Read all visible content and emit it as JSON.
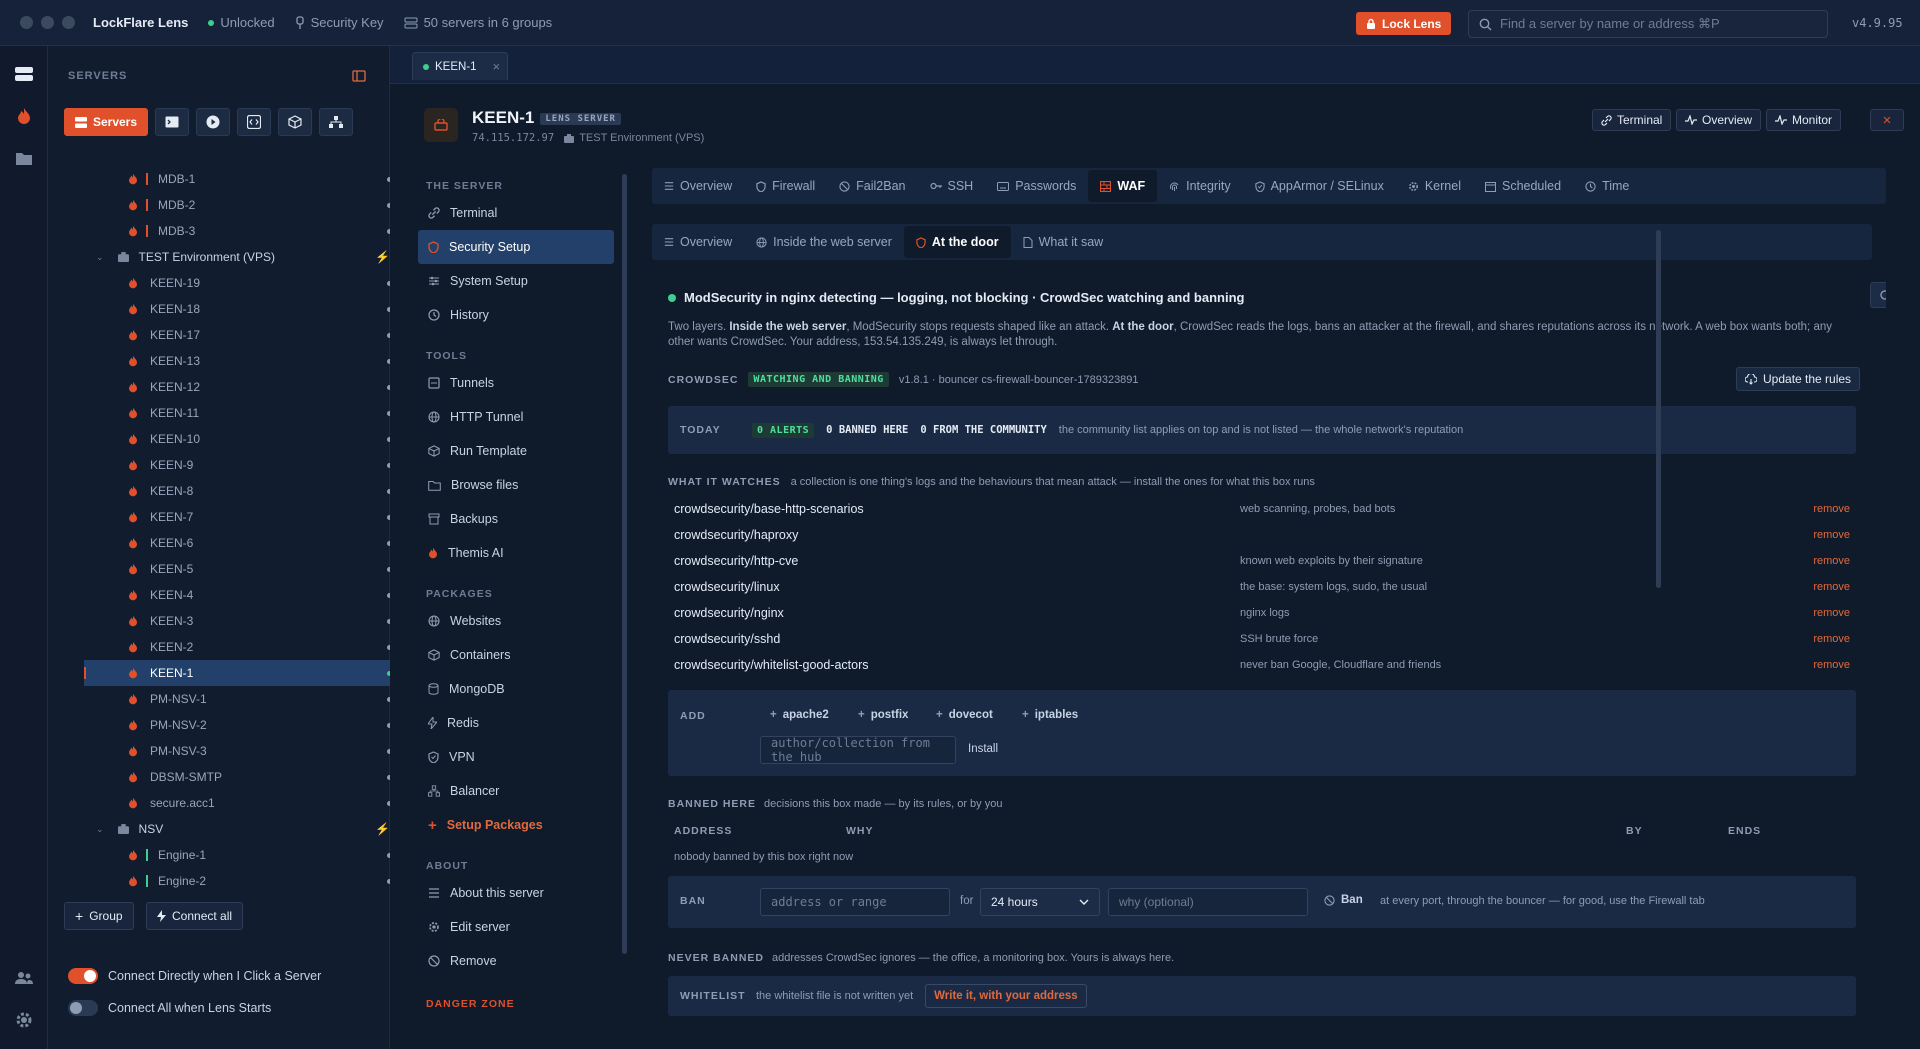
{
  "titlebar": {
    "app_name": "LockFlare Lens",
    "unlocked": "Unlocked",
    "security_key": "Security Key",
    "servers_info": "50 servers in 6 groups",
    "lock_button": "Lock Lens",
    "search_placeholder": "Find a server by name or address ⌘P",
    "version": "v4.9.95"
  },
  "sidebar": {
    "title": "SERVERS",
    "servers_tab": "Servers",
    "group_button": "Group",
    "connect_all_button": "Connect all",
    "toggles": [
      {
        "label": "Connect Directly when I Click a Server",
        "on": true
      },
      {
        "label": "Connect All when Lens Starts",
        "on": false
      }
    ],
    "tree": [
      {
        "type": "server",
        "name": "MDB-1",
        "bar": "#e0502a"
      },
      {
        "type": "server",
        "name": "MDB-2",
        "bar": "#e0502a"
      },
      {
        "type": "server",
        "name": "MDB-3",
        "bar": "#e0502a"
      },
      {
        "type": "group",
        "name": "TEST Environment (VPS)"
      },
      {
        "type": "server",
        "name": "KEEN-19"
      },
      {
        "type": "server",
        "name": "KEEN-18"
      },
      {
        "type": "server",
        "name": "KEEN-17"
      },
      {
        "type": "server",
        "name": "KEEN-13"
      },
      {
        "type": "server",
        "name": "KEEN-12"
      },
      {
        "type": "server",
        "name": "KEEN-11"
      },
      {
        "type": "server",
        "name": "KEEN-10"
      },
      {
        "type": "server",
        "name": "KEEN-9"
      },
      {
        "type": "server",
        "name": "KEEN-8"
      },
      {
        "type": "server",
        "name": "KEEN-7"
      },
      {
        "type": "server",
        "name": "KEEN-6"
      },
      {
        "type": "server",
        "name": "KEEN-5"
      },
      {
        "type": "server",
        "name": "KEEN-4"
      },
      {
        "type": "server",
        "name": "KEEN-3"
      },
      {
        "type": "server",
        "name": "KEEN-2"
      },
      {
        "type": "server",
        "name": "KEEN-1",
        "selected": true
      },
      {
        "type": "server",
        "name": "PM-NSV-1"
      },
      {
        "type": "server",
        "name": "PM-NSV-2"
      },
      {
        "type": "server",
        "name": "PM-NSV-3"
      },
      {
        "type": "server",
        "name": "DBSM-SMTP"
      },
      {
        "type": "server",
        "name": "secure.acc1"
      },
      {
        "type": "group",
        "name": "NSV"
      },
      {
        "type": "server",
        "name": "Engine-1",
        "bar": "#3ecf8e"
      },
      {
        "type": "server",
        "name": "Engine-2",
        "bar": "#3ecf8e"
      }
    ]
  },
  "tab": {
    "label": "KEEN-1"
  },
  "server": {
    "name": "KEEN-1",
    "badge": "LENS SERVER",
    "ip": "74.115.172.97",
    "env": "TEST Environment (VPS)",
    "buttons": {
      "terminal": "Terminal",
      "overview": "Overview",
      "monitor": "Monitor"
    }
  },
  "leftnav": {
    "sec_server": "THE SERVER",
    "server_items": [
      "Terminal",
      "Security Setup",
      "System Setup",
      "History"
    ],
    "sec_tools": "TOOLS",
    "tool_items": [
      "Tunnels",
      "HTTP Tunnel",
      "Run Template",
      "Browse files",
      "Backups",
      "Themis AI"
    ],
    "sec_packages": "PACKAGES",
    "package_items": [
      "Websites",
      "Containers",
      "MongoDB",
      "Redis",
      "VPN",
      "Balancer",
      "Setup Packages"
    ],
    "sec_about": "ABOUT",
    "about_items": [
      "About this server",
      "Edit server",
      "Remove"
    ],
    "danger": "DANGER ZONE"
  },
  "toptabs": [
    "Overview",
    "Firewall",
    "Fail2Ban",
    "SSH",
    "Passwords",
    "WAF",
    "Integrity",
    "AppArmor / SELinux",
    "Kernel",
    "Scheduled",
    "Time"
  ],
  "subtabs": [
    "Overview",
    "Inside the web server",
    "At the door",
    "What it saw"
  ],
  "waf": {
    "status": "ModSecurity in nginx detecting — logging, not blocking · CrowdSec watching and banning",
    "desc_1": "Two layers. ",
    "desc_b1": "Inside the web server",
    "desc_2": ", ModSecurity stops requests shaped like an attack. ",
    "desc_b2": "At the door",
    "desc_3": ", CrowdSec reads the logs, bans an attacker at the firewall, and shares reputations across its network. A web box wants both; any other wants CrowdSec. Your address, 153.54.135.249, is always let through.",
    "crowdsec_label": "CROWDSEC",
    "crowdsec_state": "WATCHING AND BANNING",
    "crowdsec_version": "v1.8.1 · bouncer cs-firewall-bouncer-1789323891",
    "update_button": "Update the rules",
    "today_label": "TODAY",
    "alerts": "0 ALERTS",
    "banned_here": "0 BANNED HERE",
    "from_community": "0 FROM THE COMMUNITY",
    "community_note": "the community list applies on top and is not listed — the whole network's reputation",
    "watches_label": "WHAT IT WATCHES",
    "watches_note": "a collection is one thing's logs and the behaviours that mean attack — install the ones for what this box runs",
    "remove_label": "remove",
    "collections": [
      {
        "name": "crowdsecurity/base-http-scenarios",
        "desc": "web scanning, probes, bad bots"
      },
      {
        "name": "crowdsecurity/haproxy",
        "desc": ""
      },
      {
        "name": "crowdsecurity/http-cve",
        "desc": "known web exploits by their signature"
      },
      {
        "name": "crowdsecurity/linux",
        "desc": "the base: system logs, sudo, the usual"
      },
      {
        "name": "crowdsecurity/nginx",
        "desc": "nginx logs"
      },
      {
        "name": "crowdsecurity/sshd",
        "desc": "SSH brute force"
      },
      {
        "name": "crowdsecurity/whitelist-good-actors",
        "desc": "never ban Google, Cloudflare and friends"
      }
    ],
    "add_label": "ADD",
    "add_chips": [
      "apache2",
      "postfix",
      "dovecot",
      "iptables"
    ],
    "add_placeholder": "author/collection from the hub",
    "install_button": "Install",
    "banned_label": "BANNED HERE",
    "banned_note": "decisions this box made — by its rules, or by you",
    "col_address": "ADDRESS",
    "col_why": "WHY",
    "col_by": "BY",
    "col_ends": "ENDS",
    "nobody": "nobody banned by this box right now",
    "ban_label": "BAN",
    "ban_addr_placeholder": "address or range",
    "ban_for": "for",
    "ban_duration": "24 hours",
    "ban_why_placeholder": "why (optional)",
    "ban_button": "Ban",
    "ban_note": "at every port, through the bouncer — for good, use the Firewall tab",
    "never_label": "NEVER BANNED",
    "never_note": "addresses CrowdSec ignores — the office, a monitoring box. Yours is always here.",
    "whitelist_label": "WHITELIST",
    "whitelist_note": "the whitelist file is not written yet",
    "write_button": "Write it, with your address"
  },
  "colors": {
    "accent": "#e0502a",
    "green": "#3ecf8e",
    "bg": "#0f1a2b"
  }
}
